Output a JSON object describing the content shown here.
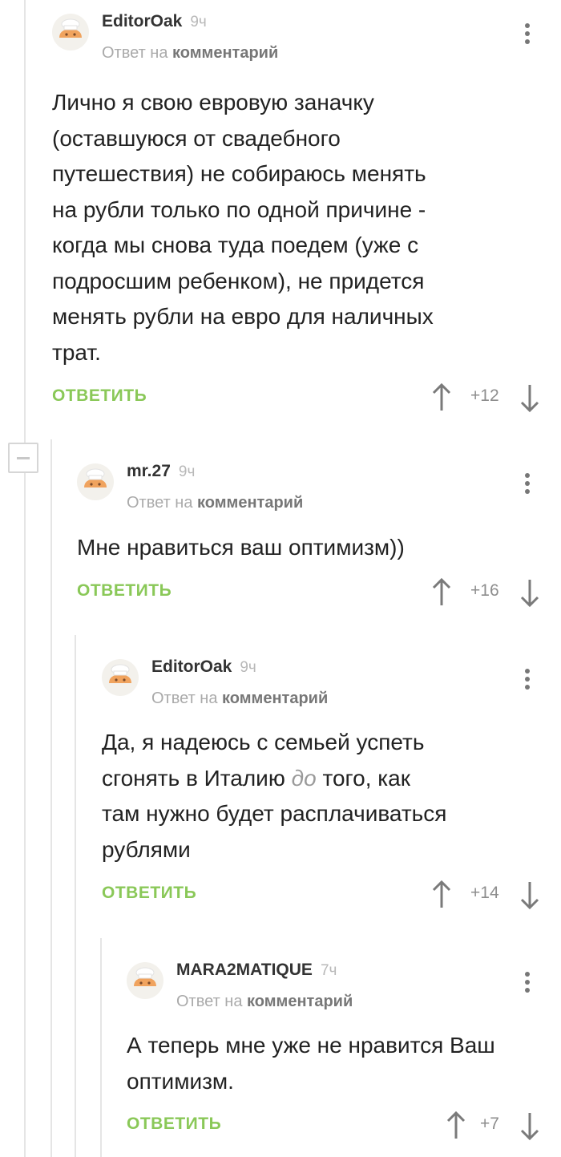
{
  "reply_prefix": "Ответ на",
  "reply_target": "комментарий",
  "reply_label": "ОТВЕТИТЬ",
  "colors": {
    "accent_green": "#8ac858",
    "thread_line": "#e5e5e5",
    "avatar": "#f0a35e"
  },
  "icons": [
    "avatar-chef-icon",
    "more-vertical-icon",
    "arrow-up-icon",
    "arrow-down-icon",
    "collapse-minus-icon"
  ],
  "comments": [
    {
      "author": "EditorOak",
      "time": "9ч",
      "lines": [
        "Лично я свою евровую заначку",
        "(оставшуюся от свадебного",
        "путешествия) не собираюсь менять",
        "на рубли только по одной причине -",
        "когда мы снова туда поедем (уже с",
        "подросшим ребенком), не придется",
        "менять рубли на евро для наличных",
        "трат."
      ],
      "score": "+12"
    },
    {
      "author": "mr.27",
      "time": "9ч",
      "lines": [
        "Мне нравиться ваш оптимизм))"
      ],
      "score": "+16"
    },
    {
      "author": "EditorOak",
      "time": "9ч",
      "lines": [
        "Да, я надеюсь с семьей успеть",
        "сгонять в Италию до того, как",
        "там нужно будет расплачиваться",
        "рублями"
      ],
      "score": "+14"
    },
    {
      "author": "MARA2MATIQUE",
      "time": "7ч",
      "lines": [
        "А теперь мне уже не нравится Ваш",
        "оптимизм."
      ],
      "score": "+7"
    }
  ]
}
